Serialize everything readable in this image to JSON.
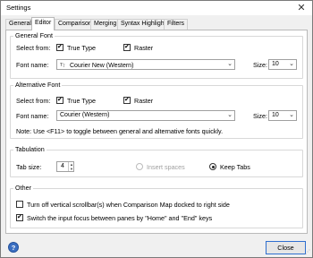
{
  "window": {
    "title": "Settings"
  },
  "tabs": [
    "General",
    "Editor",
    "Comparison",
    "Merging",
    "Syntax Highlight",
    "Filters"
  ],
  "active_tab": "Editor",
  "general_font": {
    "group_label": "General Font",
    "select_from_label": "Select from:",
    "true_type_label": "True Type",
    "true_type_checked": true,
    "raster_label": "Raster",
    "raster_checked": true,
    "font_name_label": "Font name:",
    "font_name_value": "Courier New (Western)",
    "size_label": "Size:",
    "size_value": "10"
  },
  "alternative_font": {
    "group_label": "Alternative Font",
    "select_from_label": "Select from:",
    "true_type_label": "True Type",
    "true_type_checked": true,
    "raster_label": "Raster",
    "raster_checked": true,
    "font_name_label": "Font name:",
    "font_name_value": "Courier (Western)",
    "size_label": "Size:",
    "size_value": "10",
    "note": "Note: Use <F11> to toggle between general and alternative fonts quickly."
  },
  "tabulation": {
    "group_label": "Tabulation",
    "tab_size_label": "Tab size:",
    "tab_size_value": "4",
    "insert_spaces_label": "Insert spaces",
    "insert_spaces_selected": false,
    "keep_tabs_label": "Keep Tabs",
    "keep_tabs_selected": true
  },
  "other": {
    "group_label": "Other",
    "option1_label": "Turn off vertical scrollbar(s) when Comparison Map docked to right side",
    "option1_checked": false,
    "option2_label": "Switch the input focus between panes by \"Home\" and \"End\" keys",
    "option2_checked": true
  },
  "footer": {
    "help_label": "?",
    "close_label": "Close"
  }
}
